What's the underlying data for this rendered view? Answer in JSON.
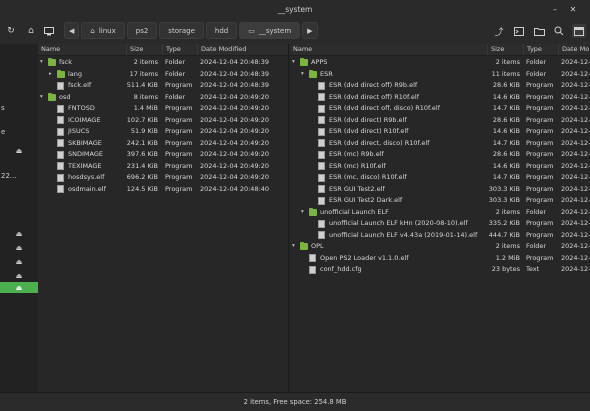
{
  "window": {
    "title": "__system"
  },
  "toolbar": {
    "crumbs": [
      "linux",
      "ps2",
      "storage",
      "hdd",
      "__system"
    ],
    "icons": [
      "reload-icon",
      "home-icon",
      "computer-icon",
      "back-arrow-icon",
      "forward-arrow-icon",
      "share-icon",
      "terminal-icon",
      "new-folder-icon",
      "search-icon",
      "view-icon"
    ]
  },
  "sidebar": {
    "text_fragments": [
      "s",
      "e",
      "22..."
    ],
    "eject_icons": 6,
    "selected_index": 5
  },
  "left_pane": {
    "headers": {
      "name": "Name",
      "size": "Size",
      "type": "Type",
      "date": "Date Modified"
    },
    "rows": [
      {
        "name": "fsck",
        "size": "2 items",
        "type": "Folder",
        "date": "2024-12-04 20:48:39",
        "kind": "folder",
        "depth": 0,
        "expander": "open"
      },
      {
        "name": "lang",
        "size": "17 items",
        "type": "Folder",
        "date": "2024-12-04 20:48:39",
        "kind": "folder",
        "depth": 1,
        "expander": "closed"
      },
      {
        "name": "fsck.elf",
        "size": "511.4 KiB",
        "type": "Program",
        "date": "2024-12-04 20:48:39",
        "kind": "file",
        "depth": 1,
        "expander": ""
      },
      {
        "name": "osd",
        "size": "8 items",
        "type": "Folder",
        "date": "2024-12-04 20:49:20",
        "kind": "folder",
        "depth": 0,
        "expander": "open"
      },
      {
        "name": "FNTOSD",
        "size": "1.4 MiB",
        "type": "Program",
        "date": "2024-12-04 20:49:20",
        "kind": "file",
        "depth": 1,
        "expander": ""
      },
      {
        "name": "ICOIMAGE",
        "size": "102.7 KiB",
        "type": "Program",
        "date": "2024-12-04 20:49:20",
        "kind": "file",
        "depth": 1,
        "expander": ""
      },
      {
        "name": "JISUCS",
        "size": "51.9 KiB",
        "type": "Program",
        "date": "2024-12-04 20:49:20",
        "kind": "file",
        "depth": 1,
        "expander": ""
      },
      {
        "name": "SKBIMAGE",
        "size": "242.1 KiB",
        "type": "Program",
        "date": "2024-12-04 20:49:20",
        "kind": "file",
        "depth": 1,
        "expander": ""
      },
      {
        "name": "SNDIMAGE",
        "size": "397.6 KiB",
        "type": "Program",
        "date": "2024-12-04 20:49:20",
        "kind": "file",
        "depth": 1,
        "expander": ""
      },
      {
        "name": "TEXIMAGE",
        "size": "231.4 KiB",
        "type": "Program",
        "date": "2024-12-04 20:49:20",
        "kind": "file",
        "depth": 1,
        "expander": ""
      },
      {
        "name": "hosdsys.elf",
        "size": "696.2 KiB",
        "type": "Program",
        "date": "2024-12-04 20:49:20",
        "kind": "file",
        "depth": 1,
        "expander": ""
      },
      {
        "name": "osdmain.elf",
        "size": "124.5 KiB",
        "type": "Program",
        "date": "2024-12-04 20:48:40",
        "kind": "file",
        "depth": 1,
        "expander": ""
      }
    ]
  },
  "right_pane": {
    "headers": {
      "name": "Name",
      "size": "Size",
      "type": "Type",
      "date": "Date Mo"
    },
    "rows": [
      {
        "name": "APPS",
        "size": "2 items",
        "type": "Folder",
        "date": "2024-12-",
        "kind": "folder",
        "depth": 0,
        "expander": "open"
      },
      {
        "name": "ESR",
        "size": "11 items",
        "type": "Folder",
        "date": "2024-12-",
        "kind": "folder",
        "depth": 1,
        "expander": "open"
      },
      {
        "name": "ESR (dvd direct off) R9b.elf",
        "size": "28.6 KiB",
        "type": "Program",
        "date": "2024-12-",
        "kind": "file",
        "depth": 2,
        "expander": ""
      },
      {
        "name": "ESR (dvd direct off) R10f.elf",
        "size": "14.6 KiB",
        "type": "Program",
        "date": "2024-12-",
        "kind": "file",
        "depth": 2,
        "expander": ""
      },
      {
        "name": "ESR (dvd direct off, disco) R10f.elf",
        "size": "14.7 KiB",
        "type": "Program",
        "date": "2024-12-",
        "kind": "file",
        "depth": 2,
        "expander": ""
      },
      {
        "name": "ESR (dvd direct) R9b.elf",
        "size": "28.6 KiB",
        "type": "Program",
        "date": "2024-12-",
        "kind": "file",
        "depth": 2,
        "expander": ""
      },
      {
        "name": "ESR (dvd direct) R10f.elf",
        "size": "14.6 KiB",
        "type": "Program",
        "date": "2024-12-",
        "kind": "file",
        "depth": 2,
        "expander": ""
      },
      {
        "name": "ESR (dvd direct, disco) R10f.elf",
        "size": "14.7 KiB",
        "type": "Program",
        "date": "2024-12-",
        "kind": "file",
        "depth": 2,
        "expander": ""
      },
      {
        "name": "ESR (mc) R9b.elf",
        "size": "28.6 KiB",
        "type": "Program",
        "date": "2024-12-",
        "kind": "file",
        "depth": 2,
        "expander": ""
      },
      {
        "name": "ESR (mc) R10f.elf",
        "size": "14.6 KiB",
        "type": "Program",
        "date": "2024-12-",
        "kind": "file",
        "depth": 2,
        "expander": ""
      },
      {
        "name": "ESR (mc, disco) R10f.elf",
        "size": "14.7 KiB",
        "type": "Program",
        "date": "2024-12-",
        "kind": "file",
        "depth": 2,
        "expander": ""
      },
      {
        "name": "ESR GUI Test2.elf",
        "size": "303.3 KiB",
        "type": "Program",
        "date": "2024-12-",
        "kind": "file",
        "depth": 2,
        "expander": ""
      },
      {
        "name": "ESR GUI Test2 Dark.elf",
        "size": "303.3 KiB",
        "type": "Program",
        "date": "2024-12-",
        "kind": "file",
        "depth": 2,
        "expander": ""
      },
      {
        "name": "unofficial Launch ELF",
        "size": "2 items",
        "type": "Folder",
        "date": "2024-12-",
        "kind": "folder",
        "depth": 1,
        "expander": "open"
      },
      {
        "name": "unofficial Launch ELF kHn (2020-08-10).elf",
        "size": "335.2 KiB",
        "type": "Program",
        "date": "2024-12-",
        "kind": "file",
        "depth": 2,
        "expander": ""
      },
      {
        "name": "unofficial Launch ELF v4.43a (2019-01-14).elf",
        "size": "444.7 KiB",
        "type": "Program",
        "date": "2024-12-",
        "kind": "file",
        "depth": 2,
        "expander": ""
      },
      {
        "name": "OPL",
        "size": "2 items",
        "type": "Folder",
        "date": "2024-12-",
        "kind": "folder",
        "depth": 0,
        "expander": "open"
      },
      {
        "name": "Open PS2 Loader v1.1.0.elf",
        "size": "1.2 MiB",
        "type": "Program",
        "date": "2024-12-",
        "kind": "file",
        "depth": 1,
        "expander": ""
      },
      {
        "name": "conf_hdd.cfg",
        "size": "23 bytes",
        "type": "Text",
        "date": "2024-12-",
        "kind": "file",
        "depth": 1,
        "expander": ""
      }
    ]
  },
  "status": {
    "text": "2 items, Free space: 254.8 MB"
  },
  "colors": {
    "accent": "#4caf50",
    "folder": "#7cb342"
  }
}
